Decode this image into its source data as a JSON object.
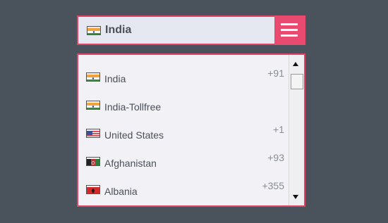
{
  "selected": {
    "country": "India",
    "flag": "flag-india-icon"
  },
  "menu_button": {
    "icon": "hamburger-menu-icon",
    "color": "#e84a70"
  },
  "colors": {
    "accent_border": "#e24467",
    "background": "#4a525c",
    "list_background": "#f1f1f6"
  },
  "countries": [
    {
      "name": "India",
      "code": "+91",
      "flag": "flag-india-icon"
    },
    {
      "name": "India-Tollfree",
      "code": "",
      "flag": "flag-india-icon"
    },
    {
      "name": "United States",
      "code": "+1",
      "flag": "flag-us-icon"
    },
    {
      "name": "Afghanistan",
      "code": "+93",
      "flag": "flag-afghanistan-icon"
    },
    {
      "name": "Albania",
      "code": "+355",
      "flag": "flag-albania-icon"
    }
  ],
  "scrollbar": {
    "position_fraction": 0.0
  }
}
